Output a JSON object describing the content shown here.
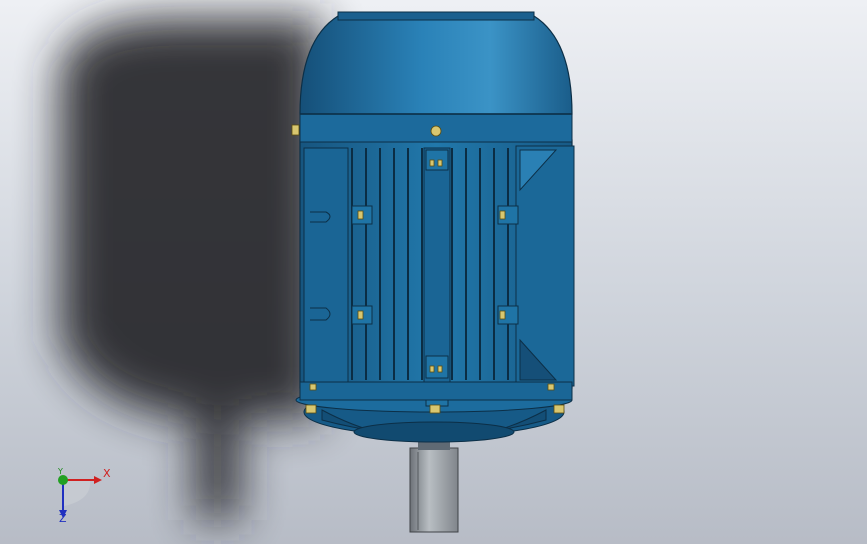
{
  "viewport": {
    "background_top": "#eef0f4",
    "background_bottom": "#b7bcc6",
    "model": "electric-motor",
    "model_color": "#1d6b9c",
    "shaft_color": "#9ea3a8",
    "shadow_color": "#2a2a2e"
  },
  "triad": {
    "x_label": "X",
    "y_label": "Y",
    "z_label": "Z",
    "x_color": "#d02020",
    "y_color": "#1a8a1a",
    "z_color": "#2030c0"
  }
}
